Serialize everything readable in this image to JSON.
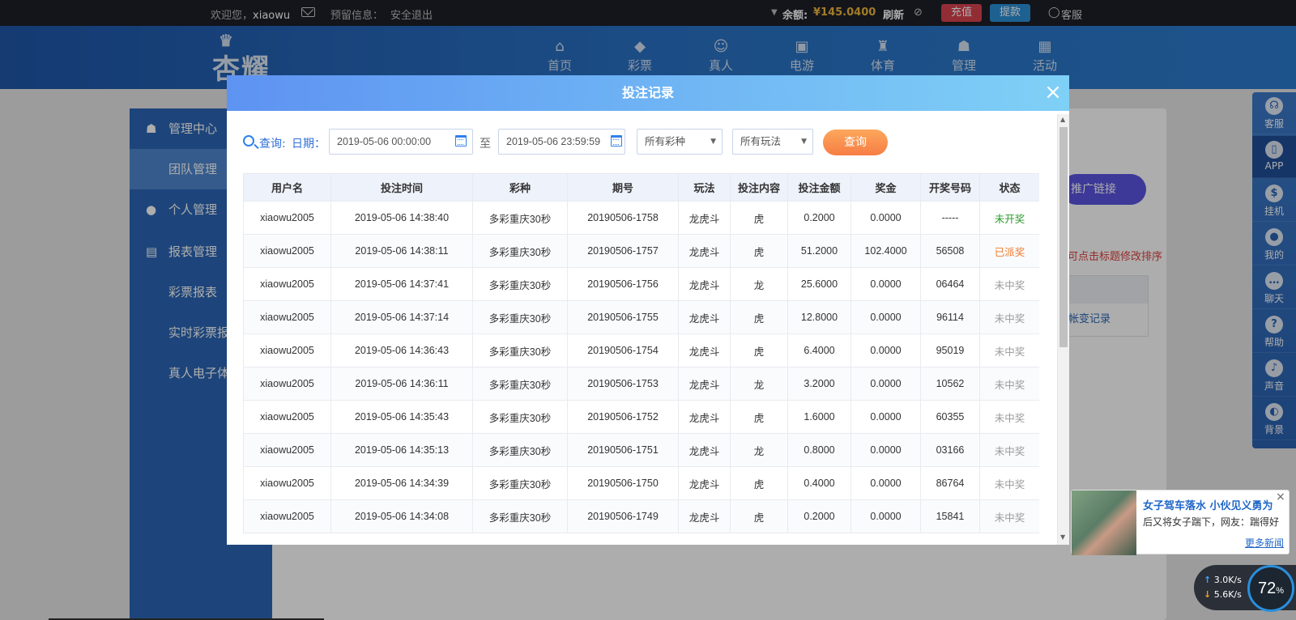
{
  "topbar": {
    "welcome": "欢迎您，",
    "username": "xiaowu",
    "reserved_label": "预留信息：",
    "logout": "安全退出",
    "balance_label": "余额:",
    "balance_value": "¥145.0400",
    "refresh": "刷新",
    "recharge": "充值",
    "withdraw": "提款",
    "service": "客服"
  },
  "header": {
    "logo_text": "杏耀",
    "nav": [
      "首页",
      "彩票",
      "真人",
      "电游",
      "体育",
      "管理",
      "活动"
    ]
  },
  "sidebar": {
    "items": [
      "管理中心",
      "团队管理",
      "个人管理",
      "报表管理",
      "彩票报表",
      "实时彩票报",
      "真人电子体"
    ]
  },
  "main": {
    "promo_button": "推广链接",
    "hint": "可点击标题修改排序",
    "side_link": "帐变记录"
  },
  "right_toolbar": [
    "客服",
    "APP",
    "挂机",
    "我的",
    "聊天",
    "帮助",
    "声音",
    "背景"
  ],
  "modal": {
    "title": "投注记录",
    "close": "×",
    "filter": {
      "query_label": "查询:",
      "date_label": "日期：",
      "start": "2019-05-06 00:00:00",
      "to": "至",
      "end": "2019-05-06 23:59:59",
      "lottery_select": "所有彩种",
      "play_select": "所有玩法",
      "query_button": "查询"
    },
    "table": {
      "headers": [
        "用户名",
        "投注时间",
        "彩种",
        "期号",
        "玩法",
        "投注内容",
        "投注金额",
        "奖金",
        "开奖号码",
        "状态"
      ],
      "rows": [
        [
          "xiaowu2005",
          "2019-05-06 14:38:40",
          "多彩重庆30秒",
          "20190506-1758",
          "龙虎斗",
          "虎",
          "0.2000",
          "0.0000",
          "-----",
          "未开奖"
        ],
        [
          "xiaowu2005",
          "2019-05-06 14:38:11",
          "多彩重庆30秒",
          "20190506-1757",
          "龙虎斗",
          "虎",
          "51.2000",
          "102.4000",
          "56508",
          "已派奖"
        ],
        [
          "xiaowu2005",
          "2019-05-06 14:37:41",
          "多彩重庆30秒",
          "20190506-1756",
          "龙虎斗",
          "龙",
          "25.6000",
          "0.0000",
          "06464",
          "未中奖"
        ],
        [
          "xiaowu2005",
          "2019-05-06 14:37:14",
          "多彩重庆30秒",
          "20190506-1755",
          "龙虎斗",
          "虎",
          "12.8000",
          "0.0000",
          "96114",
          "未中奖"
        ],
        [
          "xiaowu2005",
          "2019-05-06 14:36:43",
          "多彩重庆30秒",
          "20190506-1754",
          "龙虎斗",
          "虎",
          "6.4000",
          "0.0000",
          "95019",
          "未中奖"
        ],
        [
          "xiaowu2005",
          "2019-05-06 14:36:11",
          "多彩重庆30秒",
          "20190506-1753",
          "龙虎斗",
          "龙",
          "3.2000",
          "0.0000",
          "10562",
          "未中奖"
        ],
        [
          "xiaowu2005",
          "2019-05-06 14:35:43",
          "多彩重庆30秒",
          "20190506-1752",
          "龙虎斗",
          "虎",
          "1.6000",
          "0.0000",
          "60355",
          "未中奖"
        ],
        [
          "xiaowu2005",
          "2019-05-06 14:35:13",
          "多彩重庆30秒",
          "20190506-1751",
          "龙虎斗",
          "龙",
          "0.8000",
          "0.0000",
          "03166",
          "未中奖"
        ],
        [
          "xiaowu2005",
          "2019-05-06 14:34:39",
          "多彩重庆30秒",
          "20190506-1750",
          "龙虎斗",
          "虎",
          "0.4000",
          "0.0000",
          "86764",
          "未中奖"
        ],
        [
          "xiaowu2005",
          "2019-05-06 14:34:08",
          "多彩重庆30秒",
          "20190506-1749",
          "龙虎斗",
          "虎",
          "0.2000",
          "0.0000",
          "15841",
          "未中奖"
        ]
      ]
    }
  },
  "news": {
    "title": "女子驾车落水 小伙见义勇为",
    "desc": "后又将女子踹下，网友：踹得好",
    "more": "更多新闻",
    "close": "×"
  },
  "network": {
    "upload": "3.0",
    "download": "5.6",
    "unit": "K/s",
    "percent": "72",
    "percent_sign": "%"
  },
  "colors": {
    "accent": "#2f80ed",
    "status_pending": "#2a9a2a",
    "status_paid": "#f07a2a",
    "status_lost": "#999999"
  }
}
